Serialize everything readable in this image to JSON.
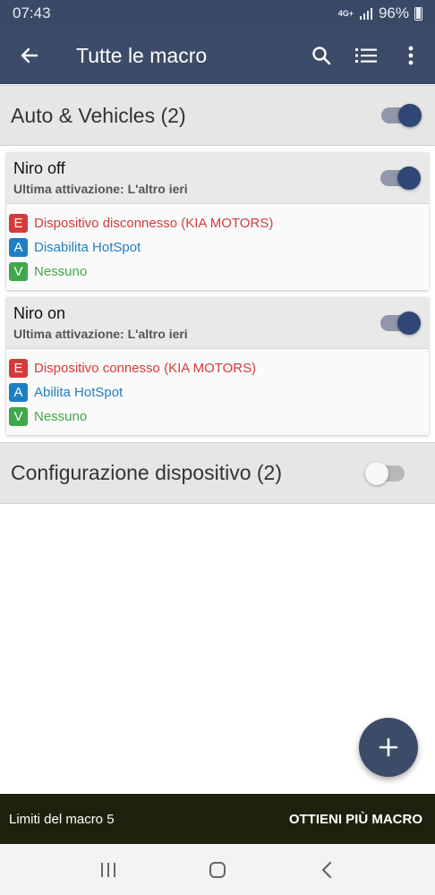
{
  "status_bar": {
    "time": "07:43",
    "network": "4G+",
    "battery": "96%"
  },
  "app_bar": {
    "title": "Tutte le macro",
    "icons": [
      "arrow-back-icon",
      "search-icon",
      "list-icon",
      "more-vert-icon"
    ]
  },
  "categories": [
    {
      "label": "Auto & Vehicles (2)",
      "enabled": true
    },
    {
      "label": "Configurazione dispositivo (2)",
      "enabled": false
    }
  ],
  "macros": [
    {
      "name": "Niro off",
      "last_run": "Ultima attivazione: L'altro ieri",
      "enabled": true,
      "rows": [
        {
          "badge": "E",
          "text": "Dispositivo disconnesso (KIA MOTORS)"
        },
        {
          "badge": "A",
          "text": "Disabilita HotSpot"
        },
        {
          "badge": "V",
          "text": "Nessuno"
        }
      ]
    },
    {
      "name": "Niro on",
      "last_run": "Ultima attivazione: L'altro ieri",
      "enabled": true,
      "rows": [
        {
          "badge": "E",
          "text": "Dispositivo connesso (KIA MOTORS)"
        },
        {
          "badge": "A",
          "text": "Abilita HotSpot"
        },
        {
          "badge": "V",
          "text": "Nessuno"
        }
      ]
    }
  ],
  "colors": {
    "primary": "#3c4b67",
    "trigger": "#d53a3a",
    "action": "#1f7fc4",
    "constraint": "#3fa84a"
  },
  "fab": {
    "icon": "plus-icon"
  },
  "snackbar": {
    "message": "Limiti del macro 5",
    "action": "OTTIENI PIÙ MACRO"
  },
  "nav_bar": {
    "icons": [
      "recents-icon",
      "home-icon",
      "back-icon"
    ]
  }
}
